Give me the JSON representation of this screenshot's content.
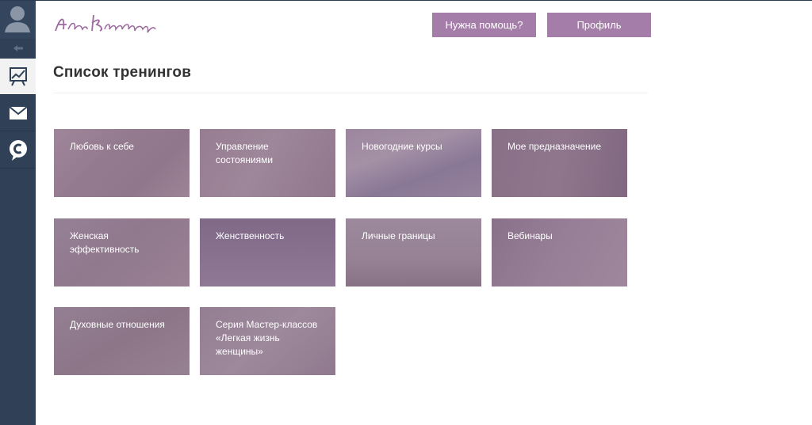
{
  "sidebar": {
    "items": [
      {
        "name": "avatar",
        "icon": "user-silhouette-icon"
      },
      {
        "name": "collapse",
        "icon": "collapse-arrow-icon"
      },
      {
        "name": "trainings",
        "icon": "chart-board-icon",
        "active": true
      },
      {
        "name": "messages",
        "icon": "envelope-icon"
      },
      {
        "name": "chat",
        "icon": "speech-bubble-icon"
      }
    ],
    "colors": {
      "background": "#2f4057",
      "active": "#f2f2f2"
    }
  },
  "header": {
    "logo_text": "Алёна Ковальчук",
    "help_button": "Нужна помощь?",
    "profile_button": "Профиль",
    "accent_color": "#a47ea8"
  },
  "main": {
    "title": "Список тренингов",
    "trainings": [
      {
        "title": "Любовь к себе"
      },
      {
        "title": "Управление состояниями"
      },
      {
        "title": "Новогодние курсы"
      },
      {
        "title": "Мое предназначение"
      },
      {
        "title": "Женская эффективность"
      },
      {
        "title": "Женственность"
      },
      {
        "title": "Личные границы"
      },
      {
        "title": "Вебинары"
      },
      {
        "title": "Духовные отношения"
      },
      {
        "title": "Серия Мастер-классов «Легкая жизнь женщины»"
      }
    ]
  }
}
